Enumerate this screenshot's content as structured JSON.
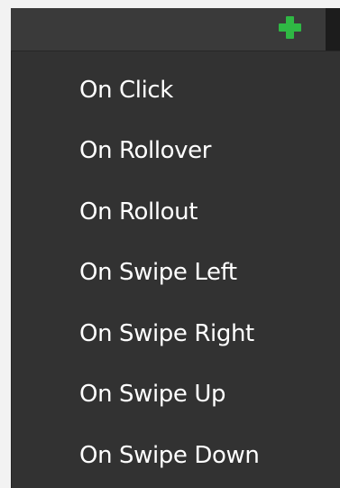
{
  "colors": {
    "add_icon": "#2fb844",
    "menu_background": "#323232",
    "header_background": "#3a3a3a",
    "menu_text": "#ffffff"
  },
  "header": {
    "add_icon": "plus-icon"
  },
  "menu": {
    "items": [
      {
        "label": "On Click"
      },
      {
        "label": "On Rollover"
      },
      {
        "label": "On Rollout"
      },
      {
        "label": "On Swipe Left"
      },
      {
        "label": "On Swipe Right"
      },
      {
        "label": "On Swipe Up"
      },
      {
        "label": "On Swipe Down"
      }
    ]
  }
}
